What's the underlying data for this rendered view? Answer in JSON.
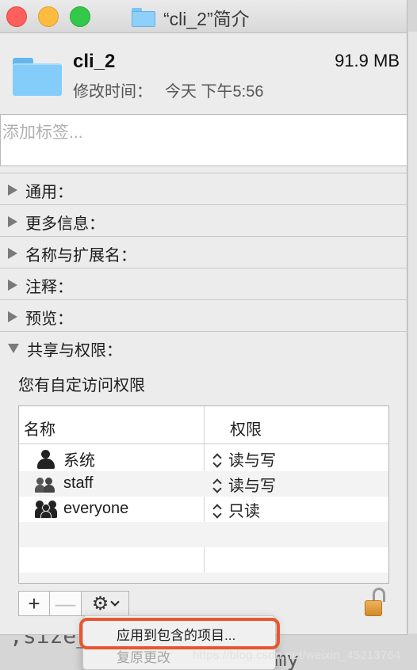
{
  "window": {
    "title": "“cli_2”简介"
  },
  "header": {
    "name": "cli_2",
    "size": "91.9 MB",
    "modified_label": "修改时间：",
    "modified_value": "今天 下午5:56"
  },
  "tags": {
    "placeholder": "添加标签..."
  },
  "sections": [
    {
      "label": "通用：",
      "expanded": false
    },
    {
      "label": "更多信息：",
      "expanded": false
    },
    {
      "label": "名称与扩展名：",
      "expanded": false
    },
    {
      "label": "注释：",
      "expanded": false
    },
    {
      "label": "预览：",
      "expanded": false
    },
    {
      "label": "共享与权限：",
      "expanded": true
    }
  ],
  "permissions": {
    "note": "您有自定访问权限",
    "columns": [
      "名称",
      "权限"
    ],
    "rows": [
      {
        "name": "系统",
        "privilege": "读与写",
        "icon": "single-user-icon"
      },
      {
        "name": "staff",
        "privilege": "读与写",
        "icon": "group-icon"
      },
      {
        "name": "everyone",
        "privilege": "只读",
        "icon": "everyone-icon"
      }
    ]
  },
  "controls": {
    "add": "+",
    "remove": "—",
    "gear": "⚙"
  },
  "menu": {
    "items": [
      "应用到包含的项目...",
      "复原更改"
    ]
  },
  "background": {
    "text_size": ",size_",
    "text_my": "my"
  },
  "watermark": "https://blog.csdn.net/weixin_45213764",
  "colors": {
    "highlight": "#e8552e",
    "folder": "#84cdfa"
  }
}
